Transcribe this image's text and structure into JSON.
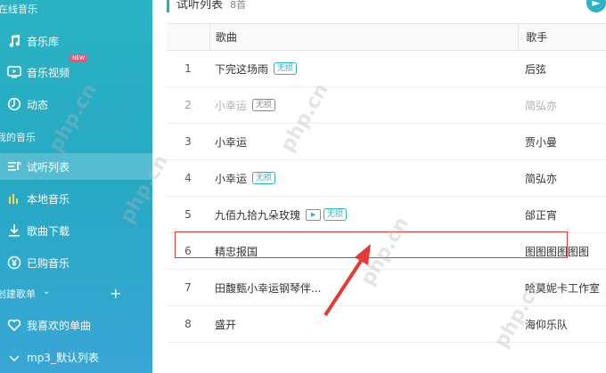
{
  "sidebar": {
    "sections": {
      "online": "在线音乐",
      "my": "我的音乐",
      "created": "创建歌单"
    },
    "items": [
      {
        "label": "音乐库",
        "icon": "music-note-icon"
      },
      {
        "label": "音乐视频",
        "icon": "video-icon",
        "badge": "NEW"
      },
      {
        "label": "动态",
        "icon": "dynamic-icon"
      },
      {
        "label": "试听列表",
        "icon": "playlist-icon",
        "active": true
      },
      {
        "label": "本地音乐",
        "icon": "bars-icon"
      },
      {
        "label": "歌曲下载",
        "icon": "download-icon"
      },
      {
        "label": "已购音乐",
        "icon": "yen-icon"
      },
      {
        "label": "我喜欢的单曲",
        "icon": "heart-icon"
      },
      {
        "label": "mp3_默认列表",
        "icon": "list-icon"
      }
    ],
    "add_label": "+"
  },
  "main": {
    "title": "试听列表",
    "count": "8首",
    "columns": {
      "song": "歌曲",
      "artist": "歌手"
    },
    "rows": [
      {
        "num": "1",
        "song": "下完这场雨",
        "tags": [
          "无损"
        ],
        "artist": "后弦"
      },
      {
        "num": "2",
        "song": "小幸运",
        "tags": [
          "无损"
        ],
        "artist": "简弘亦",
        "muted": true
      },
      {
        "num": "3",
        "song": "小幸运",
        "tags": [],
        "artist": "贾小曼"
      },
      {
        "num": "4",
        "song": "小幸运",
        "tags": [
          "无损"
        ],
        "artist": "简弘亦"
      },
      {
        "num": "5",
        "song": "九佰九拾九朵玫瑰",
        "tags": [
          "无损"
        ],
        "mv": true,
        "artist": "邰正宵"
      },
      {
        "num": "6",
        "song": "精忠报国",
        "tags": [],
        "artist": "图图图图图图"
      },
      {
        "num": "7",
        "song": "田馥甄小幸运钢琴伴...",
        "tags": [],
        "artist": "哈莫妮卡工作室"
      },
      {
        "num": "8",
        "song": "盛开",
        "tags": [],
        "artist": "海仰乐队"
      }
    ]
  },
  "watermark": "php.cn",
  "colors": {
    "accent": "#2ab3c3",
    "highlight": "#e53935"
  }
}
